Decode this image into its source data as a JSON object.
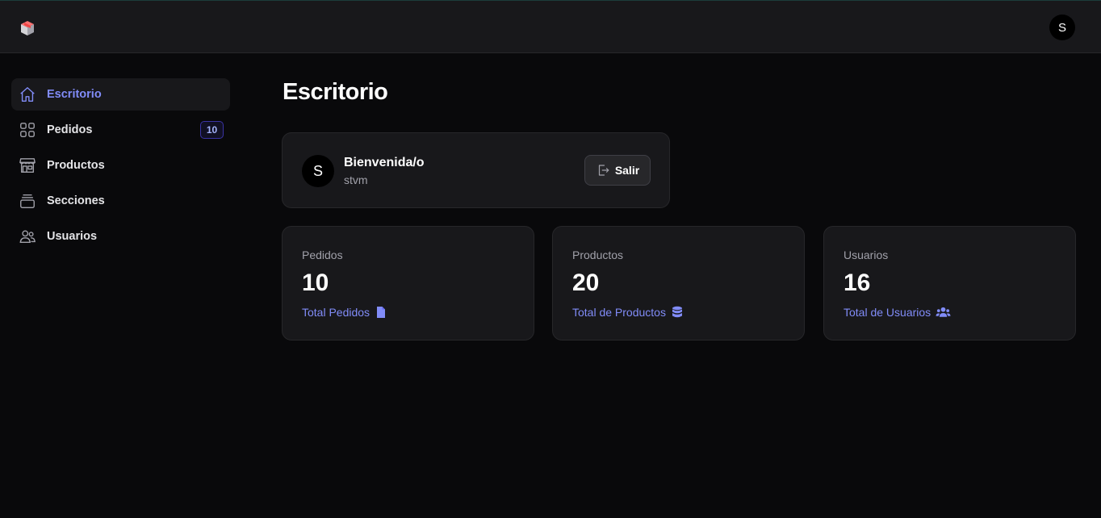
{
  "header": {
    "logo_icon": "box-logo-icon",
    "user_initial": "S"
  },
  "sidebar": {
    "items": [
      {
        "label": "Escritorio",
        "icon": "home-icon",
        "active": true
      },
      {
        "label": "Pedidos",
        "icon": "grid-icon",
        "badge": "10"
      },
      {
        "label": "Productos",
        "icon": "store-icon"
      },
      {
        "label": "Secciones",
        "icon": "stack-icon"
      },
      {
        "label": "Usuarios",
        "icon": "users-icon"
      }
    ]
  },
  "main": {
    "title": "Escritorio",
    "welcome": {
      "avatar_initial": "S",
      "greeting": "Bienvenida/o",
      "username": "stvm",
      "logout_label": "Salir"
    },
    "stats": [
      {
        "label": "Pedidos",
        "value": "10",
        "link": "Total Pedidos",
        "icon": "document-icon"
      },
      {
        "label": "Productos",
        "value": "20",
        "link": "Total de Productos",
        "icon": "database-icon"
      },
      {
        "label": "Usuarios",
        "value": "16",
        "link": "Total de Usuarios",
        "icon": "user-group-icon"
      }
    ]
  },
  "colors": {
    "accent": "#818cf8",
    "background": "#09090b",
    "surface": "#18181b",
    "border": "#27272a"
  }
}
